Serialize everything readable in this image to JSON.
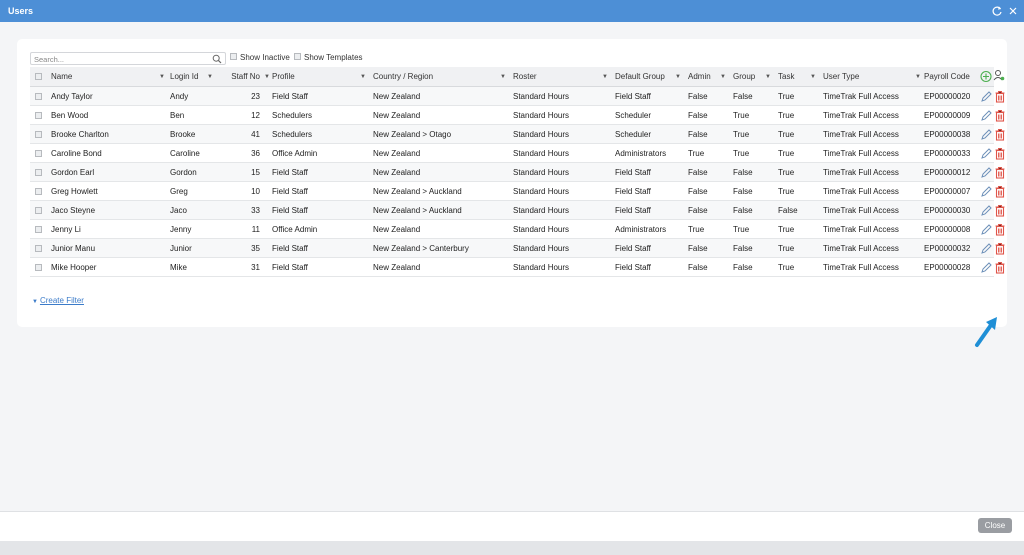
{
  "window": {
    "title": "Users"
  },
  "toolbar": {
    "search_placeholder": "Search...",
    "show_inactive": "Show Inactive",
    "show_templates": "Show Templates"
  },
  "grid": {
    "columns": [
      "Name",
      "Login Id",
      "Staff No",
      "Profile",
      "Country / Region",
      "Roster",
      "Default Group",
      "Admin",
      "Group",
      "Task",
      "User Type",
      "Payroll Code"
    ],
    "rows": [
      [
        "Andy Taylor",
        "Andy",
        "23",
        "Field Staff",
        "New Zealand",
        "Standard Hours",
        "Field Staff",
        "False",
        "False",
        "True",
        "TimeTrak Full Access",
        "EP00000020"
      ],
      [
        "Ben Wood",
        "Ben",
        "12",
        "Schedulers",
        "New Zealand",
        "Standard Hours",
        "Scheduler",
        "False",
        "True",
        "True",
        "TimeTrak Full Access",
        "EP00000009"
      ],
      [
        "Brooke Charlton",
        "Brooke",
        "41",
        "Schedulers",
        "New Zealand > Otago",
        "Standard Hours",
        "Scheduler",
        "False",
        "True",
        "True",
        "TimeTrak Full Access",
        "EP00000038"
      ],
      [
        "Caroline Bond",
        "Caroline",
        "36",
        "Office Admin",
        "New Zealand",
        "Standard Hours",
        "Administrators",
        "True",
        "True",
        "True",
        "TimeTrak Full Access",
        "EP00000033"
      ],
      [
        "Gordon Earl",
        "Gordon",
        "15",
        "Field Staff",
        "New Zealand",
        "Standard Hours",
        "Field Staff",
        "False",
        "False",
        "True",
        "TimeTrak Full Access",
        "EP00000012"
      ],
      [
        "Greg Howlett",
        "Greg",
        "10",
        "Field Staff",
        "New Zealand > Auckland",
        "Standard Hours",
        "Field Staff",
        "False",
        "False",
        "True",
        "TimeTrak Full Access",
        "EP00000007"
      ],
      [
        "Jaco Steyne",
        "Jaco",
        "33",
        "Field Staff",
        "New Zealand > Auckland",
        "Standard Hours",
        "Field Staff",
        "False",
        "False",
        "False",
        "TimeTrak Full Access",
        "EP00000030"
      ],
      [
        "Jenny Li",
        "Jenny",
        "11",
        "Office Admin",
        "New Zealand",
        "Standard Hours",
        "Administrators",
        "True",
        "True",
        "True",
        "TimeTrak Full Access",
        "EP00000008"
      ],
      [
        "Junior Manu",
        "Junior",
        "35",
        "Field Staff",
        "New Zealand > Canterbury",
        "Standard Hours",
        "Field Staff",
        "False",
        "False",
        "True",
        "TimeTrak Full Access",
        "EP00000032"
      ],
      [
        "Mike Hooper",
        "Mike",
        "31",
        "Field Staff",
        "New Zealand",
        "Standard Hours",
        "Field Staff",
        "False",
        "False",
        "True",
        "TimeTrak Full Access",
        "EP00000028"
      ]
    ]
  },
  "filter": {
    "create_label": "Create Filter"
  },
  "footer": {
    "close_label": "Close"
  },
  "icons": {
    "refresh": "refresh-icon",
    "close": "close-icon",
    "search": "search-icon",
    "add": "add-circle-icon",
    "user_settings": "user-settings-icon",
    "edit": "pencil-icon",
    "delete": "trash-icon",
    "pointer": "arrow-pointer-icon"
  },
  "colors": {
    "title_bar": "#4d8fd6",
    "link": "#3b7bc9",
    "add_icon": "#4caf50",
    "delete_icon": "#e0554a",
    "edit_icon": "#6c8fb8",
    "pointer": "#1f8fd6",
    "close_button": "#9a9da2"
  }
}
